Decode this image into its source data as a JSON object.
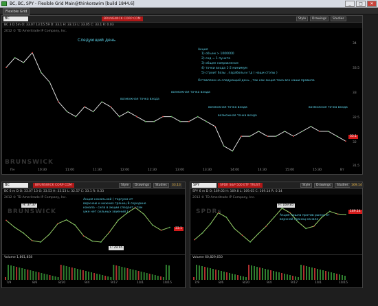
{
  "window": {
    "title": "BC, BC, SPY - Flexible Grid Main@thinkorswim [build 1844.6]",
    "controls": [
      "_",
      "□",
      "✕"
    ]
  },
  "menubar": {
    "label": "Flexible Grid"
  },
  "main": {
    "symbol": "BC",
    "brand": "BRUNSWICK CORP COM",
    "buttons": {
      "style": "Style",
      "drawings": "Drawings",
      "studies": "Studies"
    },
    "quote": "BC 3 D 5m  O: 33.07 13:15:59  O: 33.1  H: 33.13  L: 33.05  C: 33.1  R: 0.03",
    "company": "2012 © TD Ameritrade IP Company, Inc.",
    "watermark": "BRUNSWICK",
    "price_tag": "33.1",
    "y_ticks": [
      "34",
      "33.5",
      "33",
      "32.5",
      "32",
      "31.5"
    ],
    "x_ticks": [
      "Пн",
      "10:30",
      "11:00",
      "11:30",
      "12:00",
      "12:30",
      "13:00",
      "13:30",
      "14:00",
      "14:30",
      "15:00",
      "15:30",
      "Вт"
    ],
    "annotations": {
      "next_day": "Следующий день",
      "entry_points": [
        "возможная точка входа",
        "возможная точка входа",
        "возможная точка входа",
        "возможная точка входа",
        "возможная точка входа"
      ],
      "criteria_title": "Акция",
      "criteria": [
        "1) объем > 1000000",
        "2) сод = 1 пункта",
        "3) общее направление",
        "4) точки входа 1-2 минимум",
        "5) строит базы , параболы и тд ( наши стопы )"
      ],
      "note": "Оставляем на следующий день , так как акция тока все наши правила"
    },
    "chart_data": {
      "type": "line",
      "title": "",
      "xlabel": "",
      "ylabel": "",
      "ylim": [
        31.4,
        34.2
      ],
      "series": [
        {
          "name": "BC",
          "color": "#e0e0e0",
          "values": [
            33.4,
            33.6,
            33.5,
            33.7,
            33.3,
            33.1,
            32.7,
            32.5,
            32.4,
            32.6,
            32.5,
            32.7,
            32.6,
            32.4,
            32.5,
            32.4,
            32.3,
            32.3,
            32.4,
            32.4,
            32.3,
            32.3,
            32.4,
            32.3,
            32.2,
            31.8,
            31.7,
            32.0,
            32.0,
            32.1,
            32.0,
            32.0,
            32.1,
            32.0,
            32.1,
            32.2,
            32.1,
            32.1,
            32.0,
            31.9
          ]
        }
      ]
    }
  },
  "left": {
    "symbol": "BC",
    "brand": "BRUNSWICK CORP COM",
    "buttons": {
      "style": "Style",
      "drawings": "Drawings",
      "studies": "Studies"
    },
    "price_label": "33.13",
    "quote": "BC 6 m D  O: 33.07 13  O: 33.53  H: 33.53  L: 32.57  C: 33.1  R: 0.33",
    "company": "2012 © TD Ameritrade IP Company, Inc.",
    "watermark": "BRUNSWICK",
    "price_tag": "33.1",
    "hi_label": "H: 37.37",
    "lo_label": "L: 29.95",
    "annotation": "Акция нанальной ( торгуем от верхнею и нижних границ В середине канала - сила в акции следает ( там уже нет сильных хвиений ) .",
    "volume": "Volume   1,861,858",
    "x_ticks": [
      "7/9",
      "8/6",
      "8/20",
      "9/4",
      "9/17",
      "10/1",
      "10/15"
    ],
    "chart_data": {
      "type": "line",
      "ylim": [
        28,
        38.5
      ],
      "series": [
        {
          "name": "BC",
          "color": "#9ad06a",
          "values": [
            34.5,
            33.0,
            31.8,
            30.2,
            29.9,
            31.5,
            33.8,
            34.6,
            33.5,
            31.2,
            30.1,
            29.9,
            32.0,
            34.5,
            36.0,
            37.2,
            35.8,
            33.5,
            32.4,
            33.0
          ]
        }
      ]
    }
  },
  "right": {
    "symbol": "SPY",
    "brand": "SPDR S&P 500 ETF TRUST",
    "buttons": {
      "style": "Style",
      "drawings": "Drawings",
      "studies": "Studies"
    },
    "price_label": "169.14",
    "quote": "SPY 6 m D  O: 169.05  H: 169.8  L: 169.05  C: 169.14  R: 0.14",
    "company": "2012 © TD Ameritrade IP Company, Inc.",
    "watermark": "SPDRs",
    "price_tag": "169.14",
    "hi_label": "H: 169.85",
    "annotation": "Акция пошла против рынка от верхней границ канала",
    "volume": "Volume   60,829,650",
    "x_ticks": [
      "7/9",
      "8/6",
      "8/20",
      "9/4",
      "9/17",
      "10/1",
      "10/15"
    ],
    "chart_data": {
      "type": "line",
      "ylim": [
        161,
        172
      ],
      "series": [
        {
          "name": "SPY",
          "color": "#9ad06a",
          "values": [
            163.5,
            165.0,
            167.0,
            169.5,
            168.5,
            166.0,
            164.5,
            163.0,
            164.8,
            166.5,
            168.5,
            170.5,
            169.5,
            167.5,
            166.0,
            166.5,
            168.5,
            169.8,
            169.2,
            169.1
          ]
        }
      ]
    }
  }
}
